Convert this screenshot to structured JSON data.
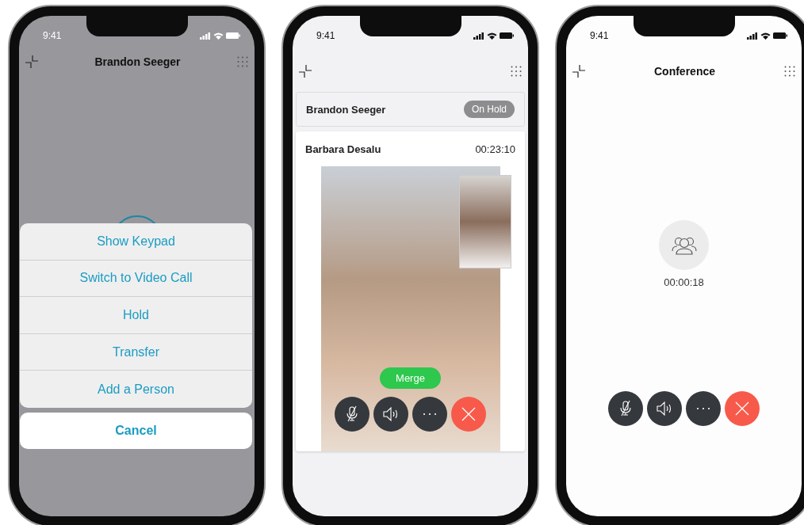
{
  "phones": [
    {
      "kind": "action_sheet",
      "status_time": "9:41",
      "title": "Brandon Seeger",
      "sheet": {
        "actions": [
          "Show Keypad",
          "Switch to Video Call",
          "Hold",
          "Transfer",
          "Add a Person"
        ],
        "cancel": "Cancel"
      }
    },
    {
      "kind": "video_call",
      "status_time": "9:41",
      "held_call": {
        "name": "Brandon Seeger",
        "badge": "On Hold"
      },
      "active_call": {
        "name": "Barbara Desalu",
        "duration": "00:23:10",
        "merge": "Merge"
      }
    },
    {
      "kind": "conference",
      "status_time": "9:41",
      "title": "Conference",
      "duration": "00:00:18"
    }
  ]
}
